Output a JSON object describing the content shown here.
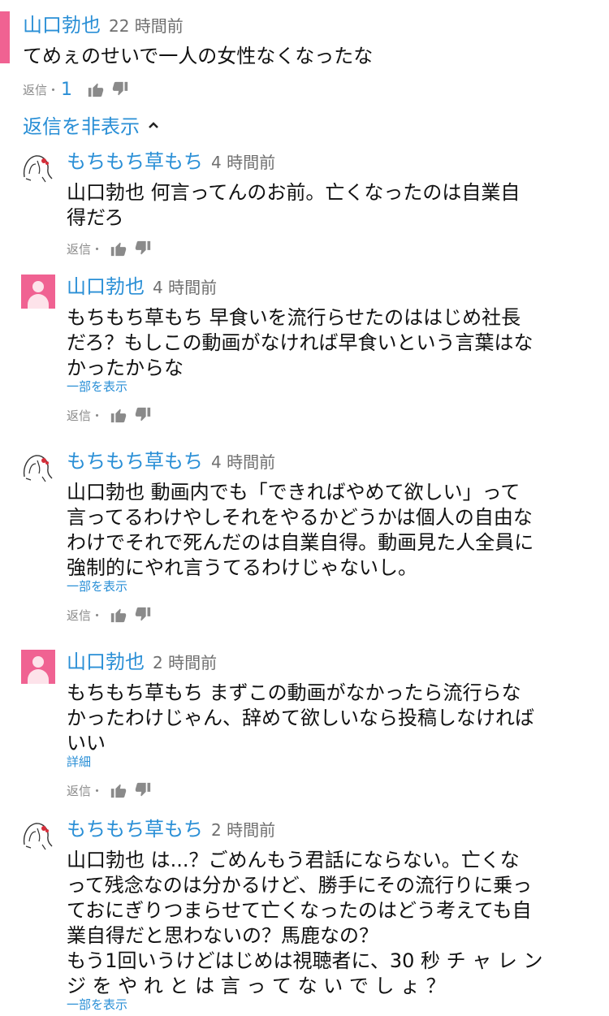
{
  "colors": {
    "link": "#2a8fd6",
    "avatar_pink": "#f06292",
    "text": "#111111",
    "meta": "#8a8a8a"
  },
  "top_comment": {
    "author": "山口勃也",
    "time": "22 時間前",
    "text": "てめぇのせいで一人の女性なくなったな",
    "reply_label": "返信・",
    "reply_count": "1",
    "hide_replies": "返信を非表示",
    "hide_replies_icon": "chevron-up-icon"
  },
  "replies": [
    {
      "author": "もちもち草もち",
      "time": "4 時間前",
      "avatar": "sketch-avatar",
      "lines": [
        "山口勃也 何言ってんのお前。亡くなったのは自業自",
        "得だろ"
      ],
      "more": "",
      "reply_label": "返信・"
    },
    {
      "author": "山口勃也",
      "time": "4 時間前",
      "avatar": "pink-avatar",
      "lines": [
        "もちもち草もち 早食いを流行らせたのははじめ社長",
        "だろ？もしこの動画がなければ早食いという言葉はな",
        "かったからな"
      ],
      "more": "一部を表示",
      "reply_label": "返信・"
    },
    {
      "author": "もちもち草もち",
      "time": "4 時間前",
      "avatar": "sketch-avatar",
      "lines": [
        "山口勃也 動画内でも「できればやめて欲しい」って",
        "言ってるわけやしそれをやるかどうかは個人の自由な",
        "わけでそれで死んだのは自業自得。動画見た人全員に",
        "強制的にやれ言うてるわけじゃないし。"
      ],
      "more": "一部を表示",
      "reply_label": "返信・"
    },
    {
      "author": "山口勃也",
      "time": "2 時間前",
      "avatar": "pink-avatar",
      "lines": [
        "もちもち草もち まずこの動画がなかったら流行らな",
        "かったわけじゃん、辞めて欲しいなら投稿しなければ",
        "いい"
      ],
      "more": "詳細",
      "reply_label": "返信・"
    },
    {
      "author": "もちもち草もち",
      "time": "2 時間前",
      "avatar": "sketch-avatar",
      "lines": [
        "山口勃也 は...？ごめんもう君話にならない。亡くな",
        "って残念なのは分かるけど、勝手にその流行りに乗っ",
        "ておにぎりつまらせて亡くなったのはどう考えても自",
        "業自得だと思わないの？馬鹿なの？",
        "もう1回いうけどはじめは視聴者に、30 秒 チ ャ レ ン",
        "ジ を や れ と は 言 っ て な い で し ょ ？"
      ],
      "more": "一部を表示",
      "reply_label": ""
    }
  ]
}
